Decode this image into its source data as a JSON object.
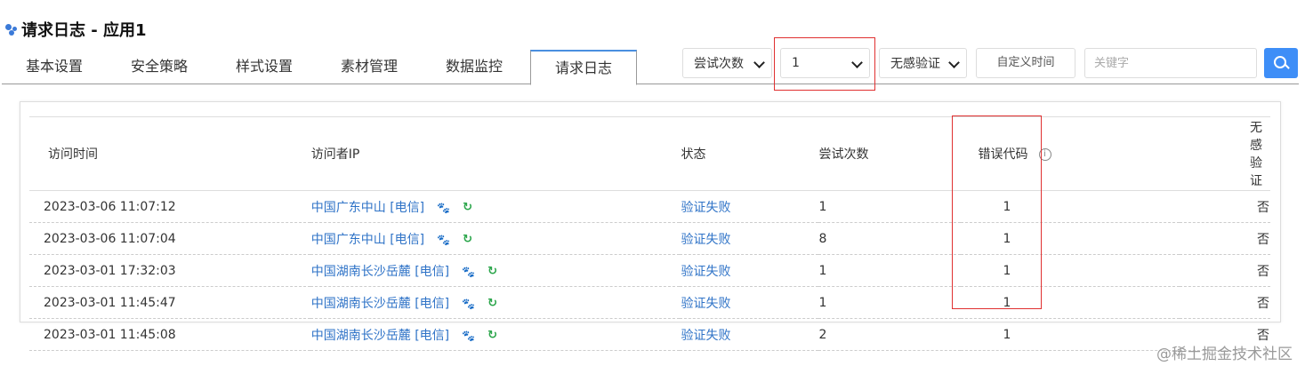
{
  "page": {
    "title": "请求日志 - 应用1"
  },
  "tabs": [
    {
      "label": "基本设置",
      "active": false
    },
    {
      "label": "安全策略",
      "active": false
    },
    {
      "label": "样式设置",
      "active": false
    },
    {
      "label": "素材管理",
      "active": false
    },
    {
      "label": "数据监控",
      "active": false
    },
    {
      "label": "请求日志",
      "active": true
    }
  ],
  "filters": {
    "attempts_label": "尝试次数",
    "attempts_value": "1",
    "seamless_label": "无感验证",
    "custom_time": "自定义时间",
    "keyword_placeholder": "关键字"
  },
  "table": {
    "headers": [
      "访问时间",
      "访问者IP",
      "状态",
      "尝试次数",
      "错误代码",
      "无感验证"
    ],
    "info_icon": "i",
    "rows": [
      {
        "time": "2023-03-06 11:07:12",
        "ip": "中国广东中山 [电信]",
        "status": "验证失败",
        "attempts": "1",
        "error_code": "1",
        "seamless": "否"
      },
      {
        "time": "2023-03-06 11:07:04",
        "ip": "中国广东中山 [电信]",
        "status": "验证失败",
        "attempts": "8",
        "error_code": "1",
        "seamless": "否"
      },
      {
        "time": "2023-03-01 17:32:03",
        "ip": "中国湖南长沙岳麓 [电信]",
        "status": "验证失败",
        "attempts": "1",
        "error_code": "1",
        "seamless": "否"
      },
      {
        "time": "2023-03-01 11:45:47",
        "ip": "中国湖南长沙岳麓 [电信]",
        "status": "验证失败",
        "attempts": "1",
        "error_code": "1",
        "seamless": "否"
      },
      {
        "time": "2023-03-01 11:45:08",
        "ip": "中国湖南长沙岳麓 [电信]",
        "status": "验证失败",
        "attempts": "2",
        "error_code": "1",
        "seamless": "否"
      }
    ]
  },
  "icons": {
    "title": "app-dots-icon",
    "locate": "paw-icon",
    "refresh": "refresh-icon",
    "search": "search-icon"
  },
  "colors": {
    "link": "#2f73c7",
    "accent": "#3e8ef7",
    "highlight": "#e03030",
    "refresh": "#2aa54a"
  },
  "watermark": "@稀土掘金技术社区"
}
